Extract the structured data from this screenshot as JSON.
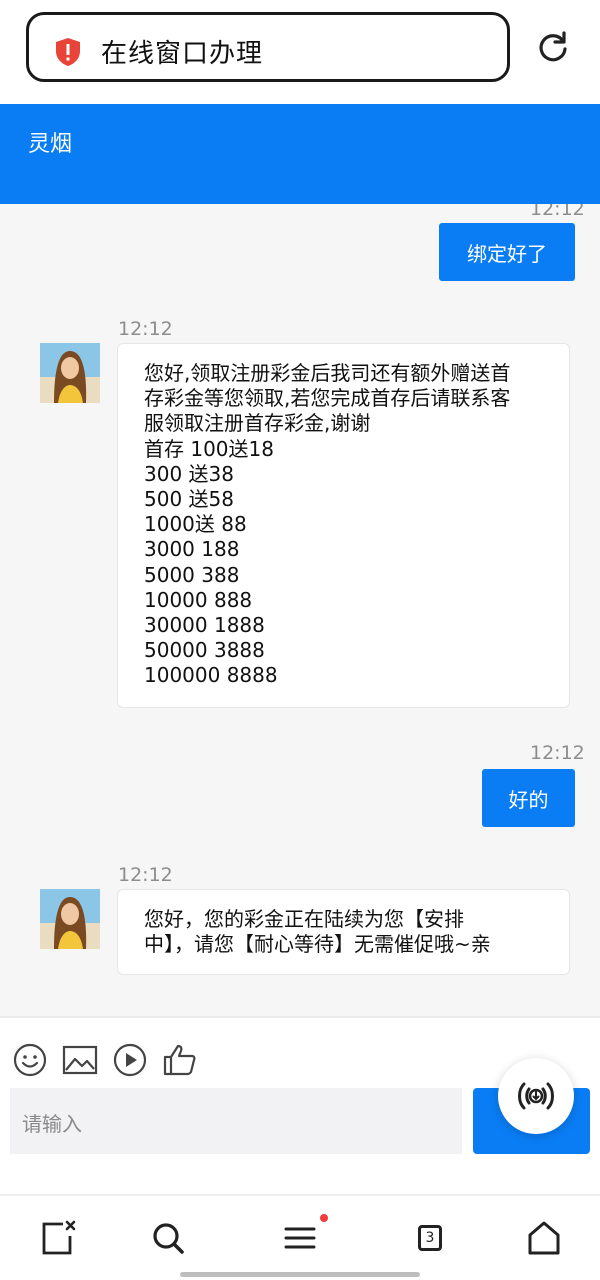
{
  "browser": {
    "url_text": "在线窗口办理",
    "shield_icon": "shield-alert-icon",
    "reload_icon": "reload-icon",
    "accent": "#e8443a"
  },
  "header": {
    "title": "灵烟",
    "color": "#0a7df5"
  },
  "messages": [
    {
      "side": "out",
      "time": "12:12",
      "text": "绑定好了"
    },
    {
      "side": "in",
      "time": "12:12",
      "text": "您好,领取注册彩金后我司还有额外赠送首\n存彩金等您领取,若您完成首存后请联系客\n服领取注册首存彩金,谢谢\n首存 100送18\n300 送38\n500 送58\n1000送 88\n3000 188\n5000 388\n10000 888\n30000 1888\n50000 3888\n100000 8888"
    },
    {
      "side": "out",
      "time": "12:12",
      "text": "好的"
    },
    {
      "side": "in",
      "time": "12:12",
      "text": "您好，您的彩金正在陆续为您【安排\n中】，请您【耐心等待】无需催促哦~亲"
    }
  ],
  "toolbar": {
    "icons": [
      "emoji-icon",
      "image-icon",
      "video-play-icon",
      "thumbs-up-icon"
    ],
    "input_placeholder": "请输入",
    "send_icon": "voice-broadcast-icon"
  },
  "navbar": {
    "icons": [
      "close-tab-icon",
      "search-icon",
      "menu-icon",
      "tabs-icon",
      "home-icon"
    ],
    "tab_count": "3"
  }
}
